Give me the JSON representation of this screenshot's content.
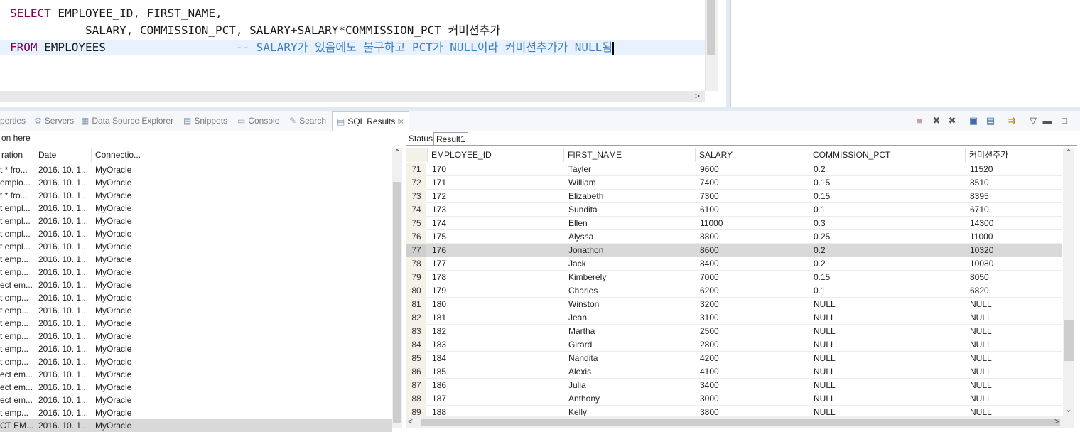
{
  "editor": {
    "line1_kw": "SELECT",
    "line1_rest": " EMPLOYEE_ID, FIRST_NAME,",
    "line2": "           SALARY, COMMISSION_PCT, SALARY+SALARY*COMMISSION_PCT 커미션추가",
    "line3_kw": "FROM",
    "line3_rest": " EMPLOYEES                   ",
    "line3_comment": "-- SALARY가 있음에도 불구하고 PCT가 NULL이라 커미션추가가 NULL됨",
    "scroll_right_glyph": ">"
  },
  "view_tabs": [
    {
      "label": "perties",
      "icon": "properties-icon"
    },
    {
      "label": "Servers",
      "icon": "servers-icon"
    },
    {
      "label": "Data Source Explorer",
      "icon": "data-source-icon"
    },
    {
      "label": "Snippets",
      "icon": "snippets-icon"
    },
    {
      "label": "Console",
      "icon": "console-icon"
    },
    {
      "label": "Search",
      "icon": "search-icon"
    },
    {
      "label": "SQL Results",
      "icon": "sql-results-icon",
      "close": "☒"
    }
  ],
  "toolbar_icons": [
    "terminate-icon",
    "remove-icon",
    "remove-all-icon",
    "save-icon",
    "export-icon",
    "pin-icon",
    "view-menu-icon",
    "minimize-icon",
    "maximize-icon"
  ],
  "history": {
    "filter_text": "on here",
    "columns": [
      "ration",
      "Date",
      "Connectio..."
    ],
    "rows": [
      {
        "op": "t * fro...",
        "date": "2016. 10. 1...",
        "conn": "MyOracle"
      },
      {
        "op": "emplo...",
        "date": "2016. 10. 1...",
        "conn": "MyOracle"
      },
      {
        "op": "t * fro...",
        "date": "2016. 10. 1...",
        "conn": "MyOracle"
      },
      {
        "op": "t empl...",
        "date": "2016. 10. 1...",
        "conn": "MyOracle"
      },
      {
        "op": "t empl...",
        "date": "2016. 10. 1...",
        "conn": "MyOracle"
      },
      {
        "op": "t empl...",
        "date": "2016. 10. 1...",
        "conn": "MyOracle"
      },
      {
        "op": "t empl...",
        "date": "2016. 10. 1...",
        "conn": "MyOracle"
      },
      {
        "op": "t  emp...",
        "date": "2016. 10. 1...",
        "conn": "MyOracle"
      },
      {
        "op": "t  emp...",
        "date": "2016. 10. 1...",
        "conn": "MyOracle"
      },
      {
        "op": "ect  em...",
        "date": "2016. 10. 1...",
        "conn": "MyOracle"
      },
      {
        "op": "t  emp...",
        "date": "2016. 10. 1...",
        "conn": "MyOracle"
      },
      {
        "op": "t  emp...",
        "date": "2016. 10. 1...",
        "conn": "MyOracle"
      },
      {
        "op": "t  emp...",
        "date": "2016. 10. 1...",
        "conn": "MyOracle"
      },
      {
        "op": "t  emp...",
        "date": "2016. 10. 1...",
        "conn": "MyOracle"
      },
      {
        "op": "t  emp...",
        "date": "2016. 10. 1...",
        "conn": "MyOracle"
      },
      {
        "op": "t  emp...",
        "date": "2016. 10. 1...",
        "conn": "MyOracle"
      },
      {
        "op": "ect  em...",
        "date": "2016. 10. 1...",
        "conn": "MyOracle"
      },
      {
        "op": "ect  em...",
        "date": "2016. 10. 1...",
        "conn": "MyOracle"
      },
      {
        "op": "ect  em...",
        "date": "2016. 10. 1...",
        "conn": "MyOracle"
      },
      {
        "op": "t  emp...",
        "date": "2016. 10. 1...",
        "conn": "MyOracle"
      },
      {
        "op": "CT EM...",
        "date": "2016. 10. 1...",
        "conn": "MyOracle",
        "selected": true
      }
    ]
  },
  "results": {
    "tabs": [
      "Status",
      "Result1"
    ],
    "columns": [
      "EMPLOYEE_ID",
      "FIRST_NAME",
      "SALARY",
      "COMMISSION_PCT",
      "커미션추가"
    ],
    "rows": [
      {
        "n": "71",
        "id": "170",
        "name": "Tayler",
        "salary": "9600",
        "pct": "0.2",
        "extra": "11520"
      },
      {
        "n": "72",
        "id": "171",
        "name": "William",
        "salary": "7400",
        "pct": "0.15",
        "extra": "8510"
      },
      {
        "n": "73",
        "id": "172",
        "name": "Elizabeth",
        "salary": "7300",
        "pct": "0.15",
        "extra": "8395"
      },
      {
        "n": "74",
        "id": "173",
        "name": "Sundita",
        "salary": "6100",
        "pct": "0.1",
        "extra": "6710"
      },
      {
        "n": "75",
        "id": "174",
        "name": "Ellen",
        "salary": "11000",
        "pct": "0.3",
        "extra": "14300"
      },
      {
        "n": "76",
        "id": "175",
        "name": "Alyssa",
        "salary": "8800",
        "pct": "0.25",
        "extra": "11000"
      },
      {
        "n": "77",
        "id": "176",
        "name": "Jonathon",
        "salary": "8600",
        "pct": "0.2",
        "extra": "10320",
        "selected": true
      },
      {
        "n": "78",
        "id": "177",
        "name": "Jack",
        "salary": "8400",
        "pct": "0.2",
        "extra": "10080"
      },
      {
        "n": "79",
        "id": "178",
        "name": "Kimberely",
        "salary": "7000",
        "pct": "0.15",
        "extra": "8050"
      },
      {
        "n": "80",
        "id": "179",
        "name": "Charles",
        "salary": "6200",
        "pct": "0.1",
        "extra": "6820"
      },
      {
        "n": "81",
        "id": "180",
        "name": "Winston",
        "salary": "3200",
        "pct": "NULL",
        "extra": "NULL"
      },
      {
        "n": "82",
        "id": "181",
        "name": "Jean",
        "salary": "3100",
        "pct": "NULL",
        "extra": "NULL"
      },
      {
        "n": "83",
        "id": "182",
        "name": "Martha",
        "salary": "2500",
        "pct": "NULL",
        "extra": "NULL"
      },
      {
        "n": "84",
        "id": "183",
        "name": "Girard",
        "salary": "2800",
        "pct": "NULL",
        "extra": "NULL"
      },
      {
        "n": "85",
        "id": "184",
        "name": "Nandita",
        "salary": "4200",
        "pct": "NULL",
        "extra": "NULL"
      },
      {
        "n": "86",
        "id": "185",
        "name": "Alexis",
        "salary": "4100",
        "pct": "NULL",
        "extra": "NULL"
      },
      {
        "n": "87",
        "id": "186",
        "name": "Julia",
        "salary": "3400",
        "pct": "NULL",
        "extra": "NULL"
      },
      {
        "n": "88",
        "id": "187",
        "name": "Anthony",
        "salary": "3000",
        "pct": "NULL",
        "extra": "NULL"
      },
      {
        "n": "89",
        "id": "188",
        "name": "Kelly",
        "salary": "3800",
        "pct": "NULL",
        "extra": "NULL"
      }
    ]
  }
}
